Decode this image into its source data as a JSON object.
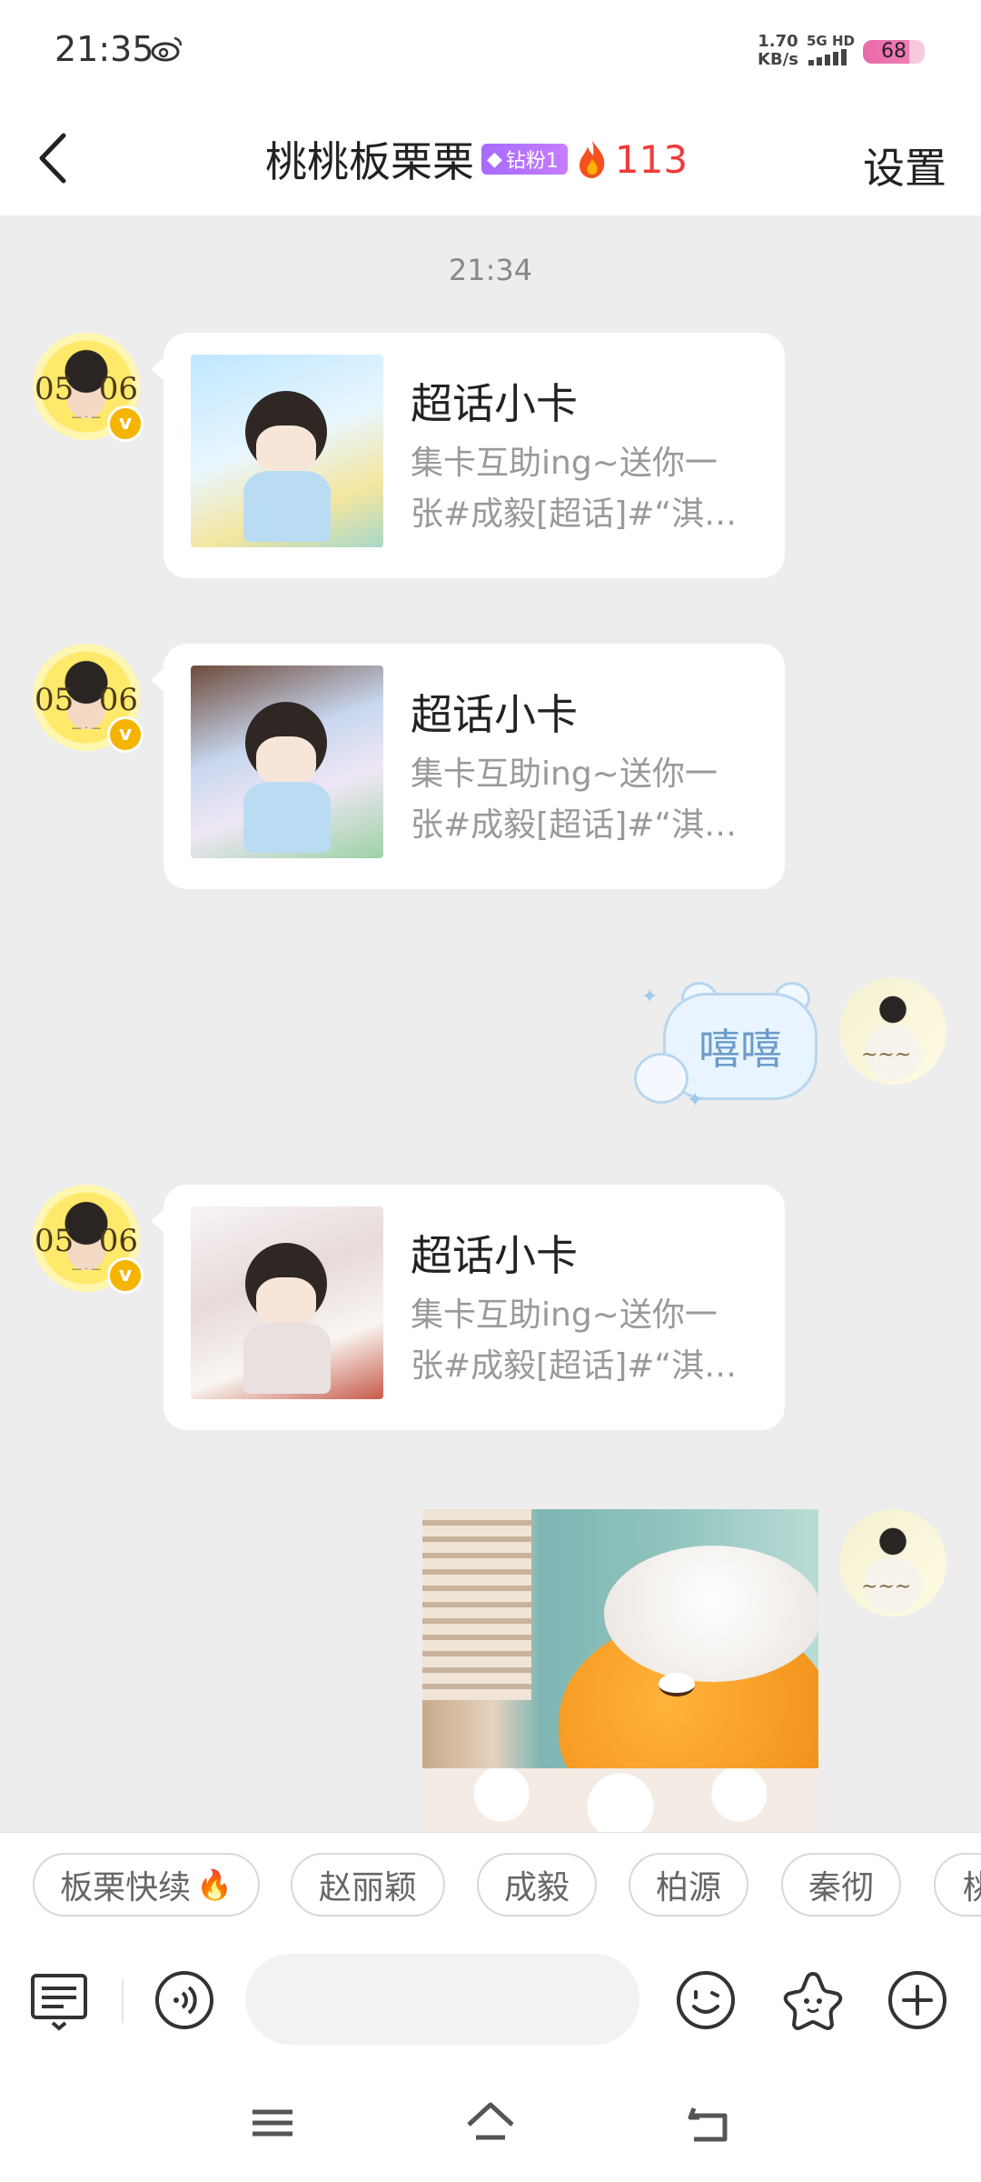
{
  "status_bar": {
    "time": "21:35",
    "network_speed_value": "1.70",
    "network_speed_unit": "KB/s",
    "network_type": "5G HD",
    "battery": "68"
  },
  "header": {
    "title": "桃桃板栗栗",
    "fan_badge": "钻粉1",
    "fire_count": "113",
    "settings": "设置"
  },
  "chat": {
    "timestamp": "21:34",
    "cards": [
      {
        "title": "超话小卡",
        "desc_line1": "集卡互助ing~送你一",
        "desc_line2": "张#成毅[超话]#“淇珍..."
      },
      {
        "title": "超话小卡",
        "desc_line1": "集卡互助ing~送你一",
        "desc_line2": "张#成毅[超话]#“淇珍..."
      },
      {
        "title": "超话小卡",
        "desc_line1": "集卡互助ing~送你一",
        "desc_line2": "张#成毅[超话]#“淇珍..."
      }
    ],
    "sticker_text": "嘻嘻"
  },
  "quick_chips": [
    "板栗快续",
    "赵丽颖",
    "成毅",
    "柏源",
    "秦彻",
    "桃"
  ],
  "colors": {
    "accent_fire": "#f03a3a",
    "badge_purple": "#a66bff",
    "background": "#ededed"
  },
  "icons": {
    "back": "chevron-left-icon",
    "keyboard": "keyboard-icon",
    "voice": "voice-icon",
    "emoji": "emoji-icon",
    "sticker": "sticker-icon",
    "add": "plus-icon",
    "menu": "menu-icon",
    "home": "home-icon",
    "back_nav": "back-icon"
  }
}
